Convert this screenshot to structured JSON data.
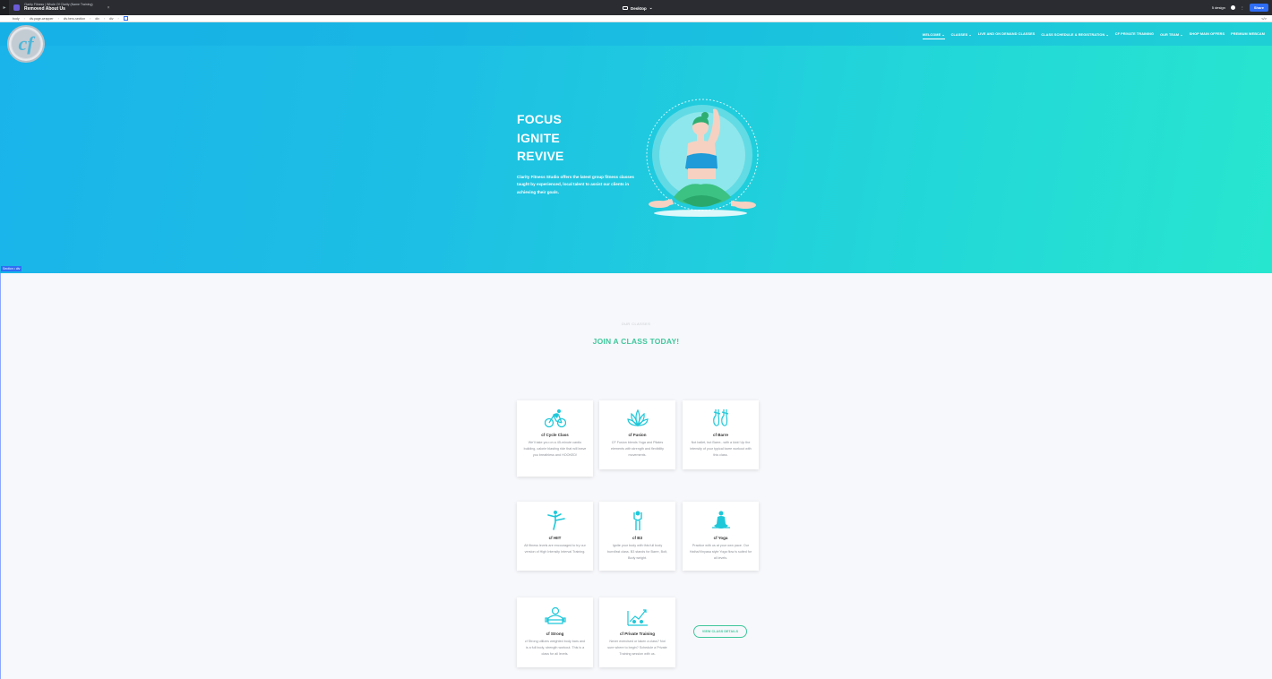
{
  "builder": {
    "site_name": "Clarity Fitness | Whole Of Clarity (Name Training)",
    "page_name": "Removed About Us",
    "close_glyph": "×",
    "device_label": "Desktop",
    "user_label": "5 design",
    "share_label": "Share",
    "breadcrumbs": [
      "body",
      "div.page-wrapper",
      "div.hero-section",
      "div",
      "div"
    ],
    "code_label": "</>"
  },
  "nav": {
    "logo_text": "cf",
    "links": [
      {
        "label": "WELCOME ⌄",
        "active": true
      },
      {
        "label": "CLASSES ⌄",
        "active": false
      },
      {
        "label": "LIVE AND ON DEMAND CLASSES",
        "active": false
      },
      {
        "label": "CLASS SCHEDULE & REGISTRATION ⌄",
        "active": false
      },
      {
        "label": "CF PRIVATE TRAINING",
        "active": false
      },
      {
        "label": "OUR TEAM ⌄",
        "active": false
      },
      {
        "label": "SHOP MAIN OFFERS",
        "active": false
      },
      {
        "label": "PREMIUM WEBCAM",
        "active": false
      }
    ]
  },
  "hero": {
    "words": [
      "FOCUS",
      "IGNITE",
      "REVIVE"
    ],
    "description": "Clarity Fitness Studio offers the latest group fitness classes taught by experienced, local talent to assist our clients in achieving their goals.",
    "illustration": "yoga-woman-illustration",
    "selection_tag": "Section • div"
  },
  "classes": {
    "eyebrow": "OUR CLASSES",
    "title": "JOIN A CLASS TODAY!",
    "cards": [
      {
        "id": "cycle",
        "icon": "cyclist-icon",
        "name": "cf Cycle Class",
        "desc": "We'll take you on a 45-minute cardio building, calorie blasting ride that will leave you breathless and HOOKED!"
      },
      {
        "id": "fusion",
        "icon": "lotus-icon",
        "name": "cf Fusion",
        "desc": "CF Fusion blends Yoga and Pilates elements with strength and flexibility movements."
      },
      {
        "id": "barre",
        "icon": "ballet-shoes-icon",
        "name": "cf Barre",
        "desc": "Not ballet, but Barre...with a kick! Up the intensity of your typical barre workout with this class."
      },
      {
        "id": "hiit",
        "icon": "kicking-figure-icon",
        "name": "cf HIIT",
        "desc": "All fitness levels are encouraged to try our version of High Intensity Interval Training."
      },
      {
        "id": "b3",
        "icon": "standing-figure-icon",
        "name": "cf B3",
        "desc": "Ignite your body with this full body burn/fast class. B3 stands for Barre, Bolt, Body weight."
      },
      {
        "id": "yoga",
        "icon": "meditation-icon",
        "name": "cf Yoga",
        "desc": "Practice with us at your own pace. Our Hatha/Vinyasa style Yoga flow is suited for all levels."
      },
      {
        "id": "strong",
        "icon": "strongman-icon",
        "name": "cf Strong",
        "desc": "cf Strong utilizes weighted body bars and is a full body, strength workout. This is a class for all levels."
      },
      {
        "id": "private",
        "icon": "progress-chart-icon",
        "name": "cf Private Training",
        "desc": "Never exercised or taken a class? Not sure where to begin? Schedule a Private Training session with us."
      }
    ],
    "view_button": "VIEW CLASS DETAILS"
  },
  "colors": {
    "accent_green": "#3fc79c",
    "icon_teal": "#1fc8d9",
    "hero_start": "#1ab4ea",
    "hero_end": "#27e6cf"
  }
}
